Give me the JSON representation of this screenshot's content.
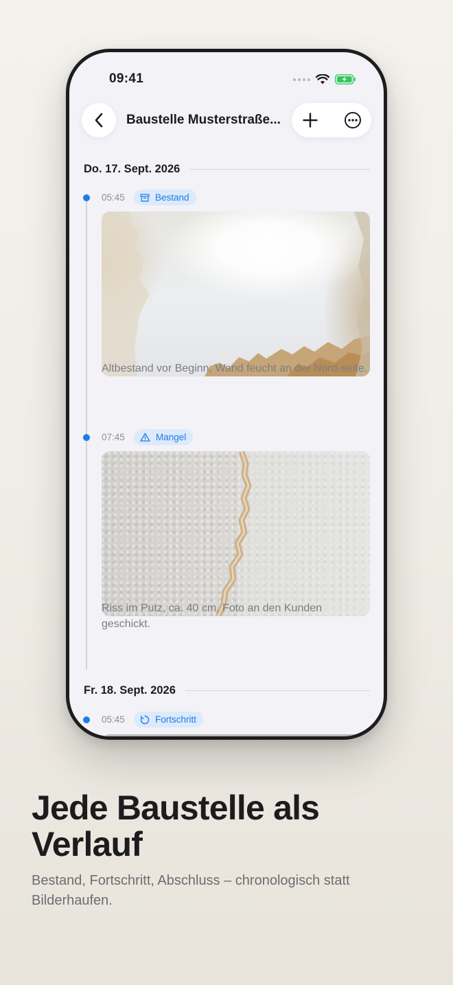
{
  "status_bar": {
    "time": "09:41"
  },
  "nav": {
    "title": "Baustelle Musterstraße...",
    "back_icon": "chevron-left-icon",
    "add_icon": "plus-icon",
    "more_icon": "ellipsis-circle-icon"
  },
  "days": [
    {
      "date": "Do. 17. Sept. 2026",
      "entries": [
        {
          "time": "05:45",
          "tag": "Bestand",
          "tag_icon": "archive-box-icon",
          "caption": "Altbestand vor Beginn, Wand feucht an der Nord-seite."
        },
        {
          "time": "07:45",
          "tag": "Mangel",
          "tag_icon": "warning-triangle-icon",
          "caption": "Riss im Putz, ca. 40 cm, Foto an den Kunden geschickt."
        }
      ]
    },
    {
      "date": "Fr. 18. Sept. 2026",
      "entries": [
        {
          "time": "05:45",
          "tag": "Fortschritt",
          "tag_icon": "progress-circle-icon"
        }
      ]
    }
  ],
  "hero": {
    "title": "Jede Baustelle als Verlauf",
    "subtitle": "Bestand, Fortschritt, Abschluss – chronologisch statt Bilderhaufen."
  },
  "colors": {
    "accent": "#1e7ce6",
    "badge_bg": "#dceafb",
    "battery_green": "#34c759"
  }
}
